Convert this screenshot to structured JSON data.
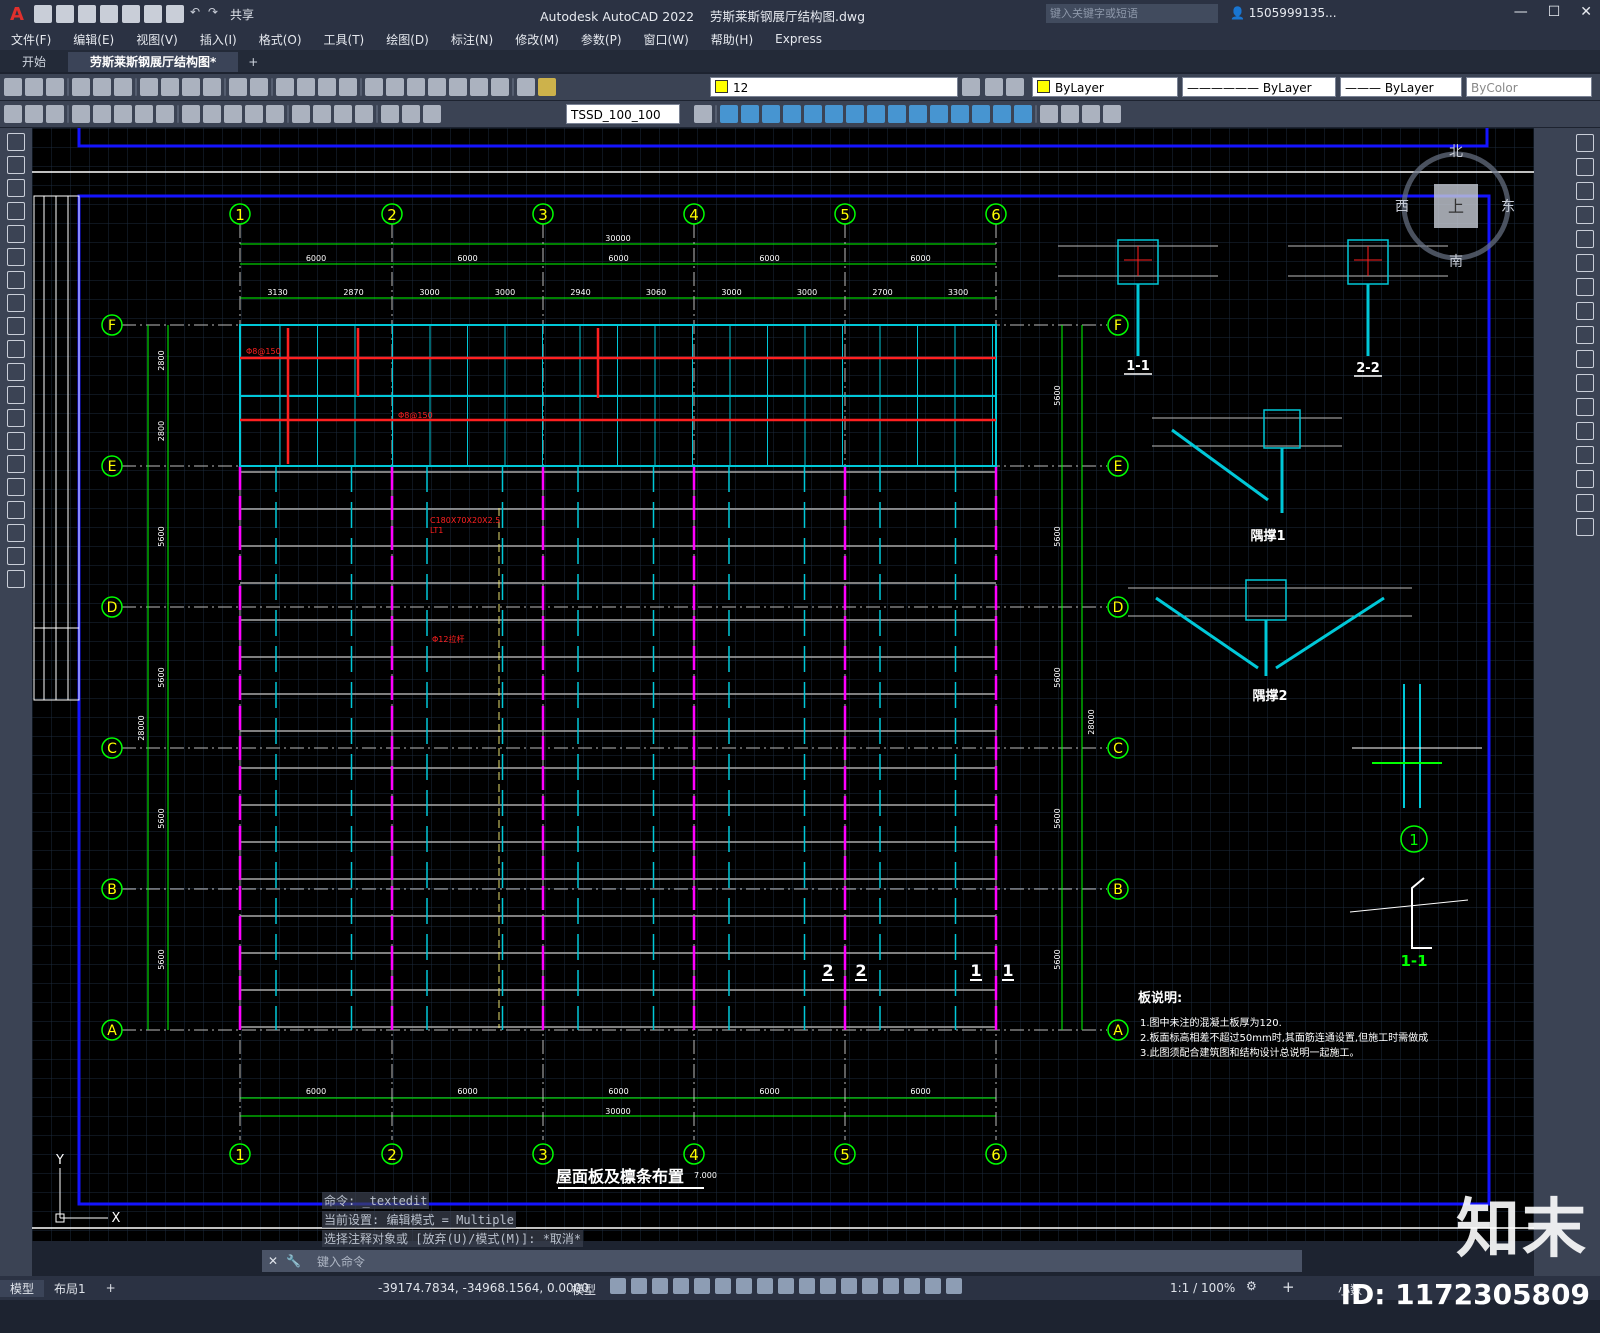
{
  "app": {
    "title": "Autodesk AutoCAD 2022",
    "filename": "劳斯莱斯钢展厅结构图.dwg",
    "search_placeholder": "键入关键字或短语",
    "user": "1505999135...",
    "share_label": "共享"
  },
  "menu": [
    "文件(F)",
    "编辑(E)",
    "视图(V)",
    "插入(I)",
    "格式(O)",
    "工具(T)",
    "绘图(D)",
    "标注(N)",
    "修改(M)",
    "参数(P)",
    "窗口(W)",
    "帮助(H)",
    "Express"
  ],
  "tabs": [
    "开始",
    "劳斯莱斯钢展厅结构图*"
  ],
  "toolbar": {
    "layer_value": "12",
    "color_value": "ByLayer",
    "linetype_value": "ByLayer",
    "lineweight_value": "ByLayer",
    "plotstyle_value": "ByColor",
    "dimstyle_value": "TSSD_100_100"
  },
  "drawing": {
    "col_labels": [
      "1",
      "2",
      "3",
      "4",
      "5",
      "6"
    ],
    "row_labels": [
      "F",
      "E",
      "D",
      "C",
      "B",
      "A"
    ],
    "top_total": "30000",
    "bay_dims": [
      "6000",
      "6000",
      "6000",
      "6000",
      "6000"
    ],
    "sub_dims": [
      "3130",
      "2870",
      "3000",
      "3000",
      "2940",
      "3060",
      "3000",
      "3000",
      "2700",
      "3300"
    ],
    "row_dims": [
      "2800",
      "2800",
      "5600",
      "5600",
      "5600",
      "5600"
    ],
    "side_total": "28000",
    "right_row_dims": [
      "5600",
      "5600",
      "5600",
      "5600",
      "5600"
    ],
    "plan_title": "屋面板及檩条布置",
    "plan_scale": "7.000",
    "section_labels": [
      "2",
      "2",
      "1",
      "1"
    ],
    "detail_titles": [
      "1-1",
      "2-2",
      "隅撑1",
      "隅撑2",
      "1-1"
    ],
    "detail_circle": "1",
    "purlin_label": "C180X70X20X2.5",
    "purlin_sub": "LT1",
    "rebar_label": "Φ8@150",
    "brace_label": "Φ12拉杆",
    "notes_title": "板说明:",
    "notes": [
      "1.图中未注的混凝土板厚为120.",
      "2.板面标高相差不超过50mm时,其面筋连通设置,但施工时需做成",
      "3.此图须配合建筑图和结构设计总说明一起施工。"
    ],
    "compass": {
      "n": "北",
      "s": "南",
      "e": "东",
      "w": "西",
      "center": "上"
    }
  },
  "command": {
    "history": [
      "命令: _textedit",
      "当前设置: 编辑模式 = Multiple",
      "选择注释对象或 [放弃(U)/模式(M)]: *取消*"
    ],
    "placeholder": "键入命令"
  },
  "status": {
    "model_tab": "模型",
    "layout_tab": "布局1",
    "coords": "-39174.7834, -34968.1564, 0.0000",
    "space": "模型",
    "scale": "1:1 / 100%",
    "units": "小数"
  },
  "watermark": {
    "brand": "知末",
    "id": "ID: 1172305809"
  },
  "colors": {
    "accent": "#4aa3e8",
    "grid_green": "#00ff00",
    "axis_cyan": "#00c8d8",
    "magenta": "#ff00ff",
    "red": "#ff2020",
    "frame_blue": "#1414ff"
  }
}
